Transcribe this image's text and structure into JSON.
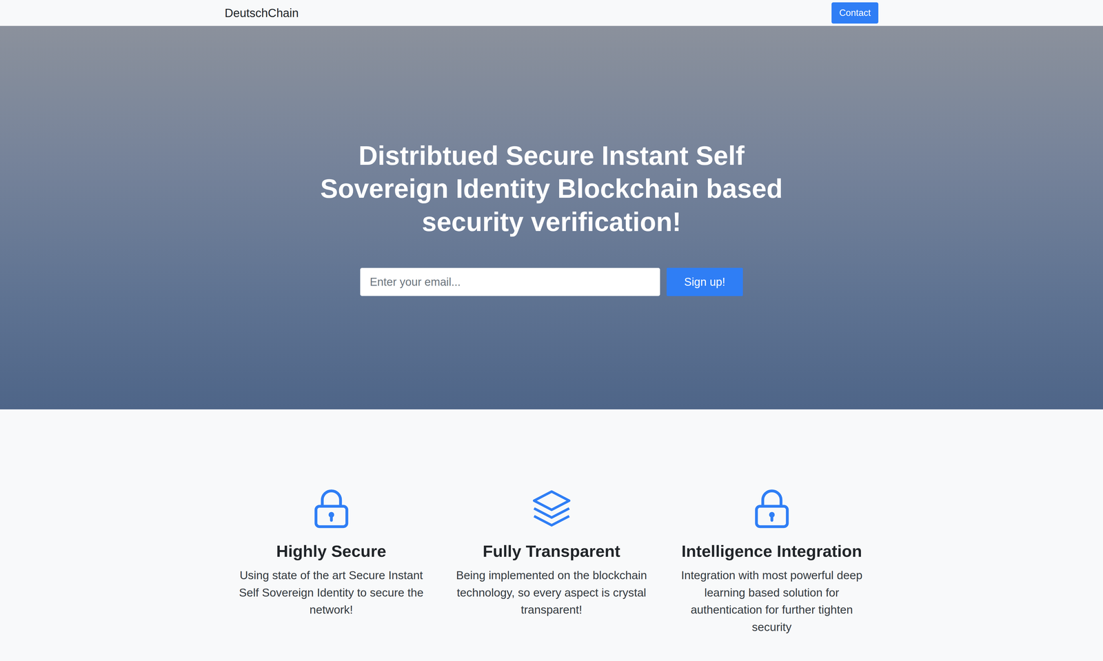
{
  "brand": "DeutschChain",
  "nav": {
    "contact": "Contact"
  },
  "hero": {
    "title": "Distribtued Secure Instant Self Sovereign Identity Blockchain based security verification!",
    "email_placeholder": "Enter your email...",
    "signup": "Sign up!"
  },
  "features": [
    {
      "kind": "lock",
      "title": "Highly Secure",
      "text": "Using state of the art Secure Instant Self Sovereign Identity to secure the network!"
    },
    {
      "kind": "layers",
      "title": "Fully Transparent",
      "text": "Being implemented on the blockchain technology, so every aspect is crystal transparent!"
    },
    {
      "kind": "lock",
      "title": "Intelligence Integration",
      "text": "Integration with most powerful deep learning based solution for authentication for further tighten security"
    }
  ]
}
